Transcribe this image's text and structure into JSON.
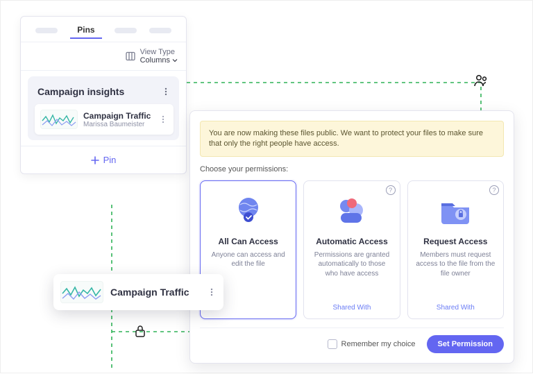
{
  "tabs": {
    "active": "Pins"
  },
  "view_type": {
    "title": "View Type",
    "value": "Columns"
  },
  "insights": {
    "title": "Campaign insights",
    "card": {
      "title": "Campaign Traffic",
      "author": "Marissa Baumeister"
    }
  },
  "pin_button": "Pin",
  "drag_card": {
    "title": "Campaign Traffic"
  },
  "modal": {
    "banner": "You are now making these files public. We want to protect your files to make sure that only the right people have access.",
    "choose_label": "Choose your permissions:",
    "options": [
      {
        "title": "All Can Access",
        "desc": "Anyone can access and edit the file",
        "shared": null
      },
      {
        "title": "Automatic Access",
        "desc": "Permissions are granted automatically to those who have access",
        "shared": "Shared With"
      },
      {
        "title": "Request Access",
        "desc": "Members must request access to the file from the file owner",
        "shared": "Shared With"
      }
    ],
    "remember": "Remember my choice",
    "submit": "Set Permission"
  }
}
